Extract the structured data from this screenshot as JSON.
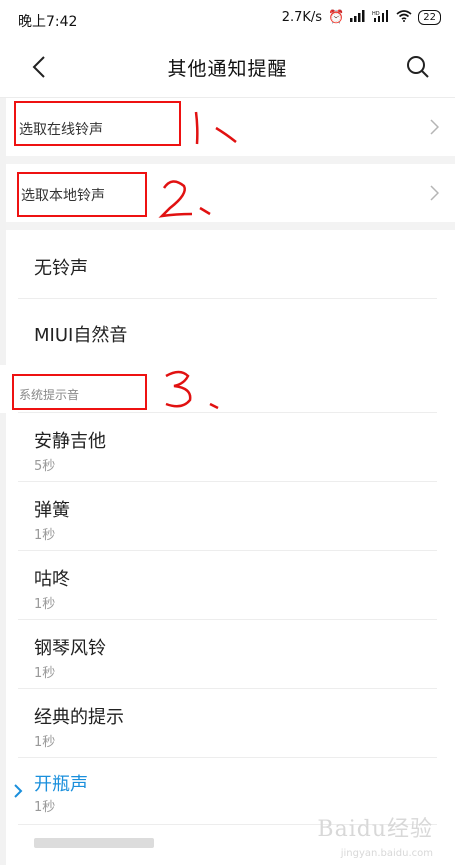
{
  "status_bar": {
    "time": "晚上7:42",
    "speed": "2.7K/s",
    "battery": "22"
  },
  "header": {
    "title": "其他通知提醒"
  },
  "options": {
    "online_ringtone": "选取在线铃声",
    "local_ringtone": "选取本地铃声"
  },
  "items_top": [
    {
      "title": "无铃声"
    },
    {
      "title": "MIUI自然音"
    }
  ],
  "section": {
    "label": "系统提示音"
  },
  "sounds": [
    {
      "title": "安静吉他",
      "duration": "5秒"
    },
    {
      "title": "弹簧",
      "duration": "1秒"
    },
    {
      "title": "咕咚",
      "duration": "1秒"
    },
    {
      "title": "钢琴风铃",
      "duration": "1秒"
    },
    {
      "title": "经典的提示",
      "duration": "1秒"
    },
    {
      "title": "开瓶声",
      "duration": "1秒",
      "selected": true
    }
  ],
  "annotations": [
    "1、",
    "2、",
    "3、"
  ],
  "colors": {
    "accent": "#1a8fdc",
    "annotation": "#e11111",
    "band": "#f3f3f3"
  },
  "watermark": "Baidu经验",
  "watermark_url": "jingyan.baidu.com"
}
